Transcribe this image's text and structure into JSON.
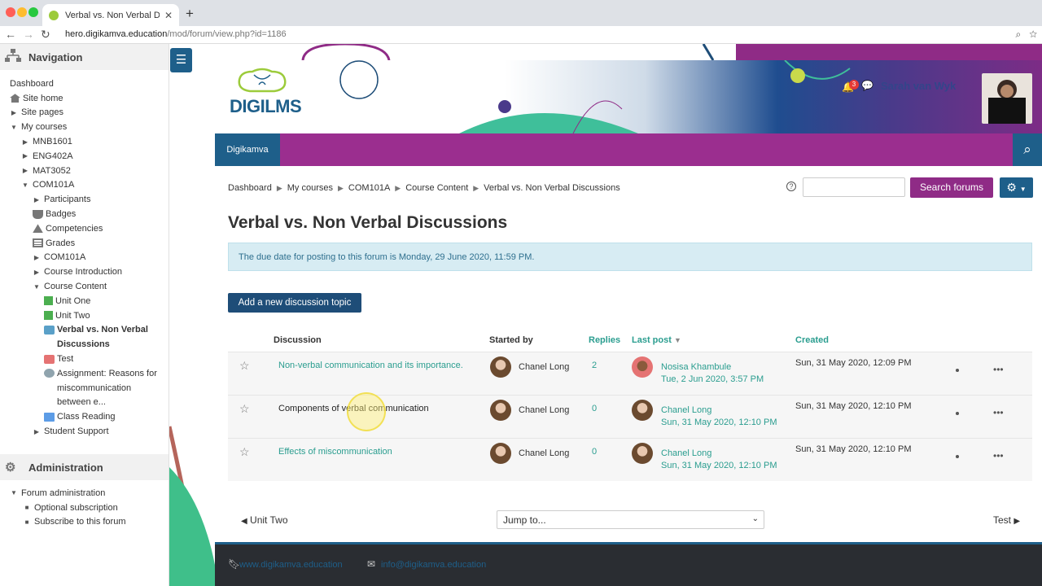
{
  "browser": {
    "tab_title": "Verbal vs. Non Verbal Discussio",
    "url_domain": "hero.digikamva.education",
    "url_path": "/mod/forum/view.php?id=1186"
  },
  "navigation": {
    "title": "Navigation",
    "items": [
      {
        "label": "Dashboard"
      },
      {
        "label": "Site home"
      },
      {
        "label": "Site pages"
      },
      {
        "label": "My courses"
      },
      {
        "label": "MNB1601"
      },
      {
        "label": "ENG402A"
      },
      {
        "label": "MAT3052"
      },
      {
        "label": "COM101A"
      },
      {
        "label": "Participants"
      },
      {
        "label": "Badges"
      },
      {
        "label": "Competencies"
      },
      {
        "label": "Grades"
      },
      {
        "label": "COM101A"
      },
      {
        "label": "Course Introduction"
      },
      {
        "label": "Course Content"
      },
      {
        "label": "Unit One"
      },
      {
        "label": "Unit Two"
      },
      {
        "label": "Verbal vs. Non Verbal"
      },
      {
        "label": "Discussions"
      },
      {
        "label": "Test"
      },
      {
        "label": "Assignment: Reasons for"
      },
      {
        "label": "miscommunication"
      },
      {
        "label": "between e..."
      },
      {
        "label": "Class Reading"
      },
      {
        "label": "Student Support"
      }
    ]
  },
  "administration": {
    "title": "Administration",
    "items": [
      {
        "label": "Forum administration"
      },
      {
        "label": "Optional subscription"
      },
      {
        "label": "Subscribe to this forum"
      }
    ]
  },
  "header": {
    "logo_digi": "DIGI",
    "logo_lms": "LMS",
    "user_name": "Sarah van Wyk",
    "notification_count": "3"
  },
  "menubar": {
    "brand": "Digikamva"
  },
  "breadcrumb": [
    "Dashboard",
    "My courses",
    "COM101A",
    "Course Content",
    "Verbal vs. Non Verbal Discussions"
  ],
  "search": {
    "button_label": "Search forums",
    "placeholder": ""
  },
  "page": {
    "title": "Verbal vs. Non Verbal Discussions",
    "alert": "The due date for posting to this forum is Monday, 29 June 2020, 11:59 PM.",
    "add_button": "Add a new discussion topic"
  },
  "table": {
    "headers": {
      "discussion": "Discussion",
      "started_by": "Started by",
      "replies": "Replies",
      "last_post": "Last post",
      "created": "Created"
    },
    "rows": [
      {
        "topic": "Non-verbal communication and its importance.",
        "starter": "Chanel Long",
        "replies": "2",
        "last_post_name": "Nosisa Khambule",
        "last_post_date": "Tue, 2 Jun 2020, 3:57 PM",
        "created": "Sun, 31 May 2020, 12:09 PM"
      },
      {
        "topic": "Components of verbal communication",
        "starter": "Chanel Long",
        "replies": "0",
        "last_post_name": "Chanel Long",
        "last_post_date": "Sun, 31 May 2020, 12:10 PM",
        "created": "Sun, 31 May 2020, 12:10 PM"
      },
      {
        "topic": "Effects of miscommunication",
        "starter": "Chanel Long",
        "replies": "0",
        "last_post_name": "Chanel Long",
        "last_post_date": "Sun, 31 May 2020, 12:10 PM",
        "created": "Sun, 31 May 2020, 12:10 PM"
      }
    ]
  },
  "pager": {
    "prev": "Unit Two",
    "jump": "Jump to...",
    "next": "Test"
  },
  "footer": {
    "website": "www.digikamva.education",
    "email": "info@digikamva.education"
  },
  "colors": {
    "primary": "#1e5f8a",
    "accent": "#9b2e8f",
    "link": "#2a9d8f"
  }
}
